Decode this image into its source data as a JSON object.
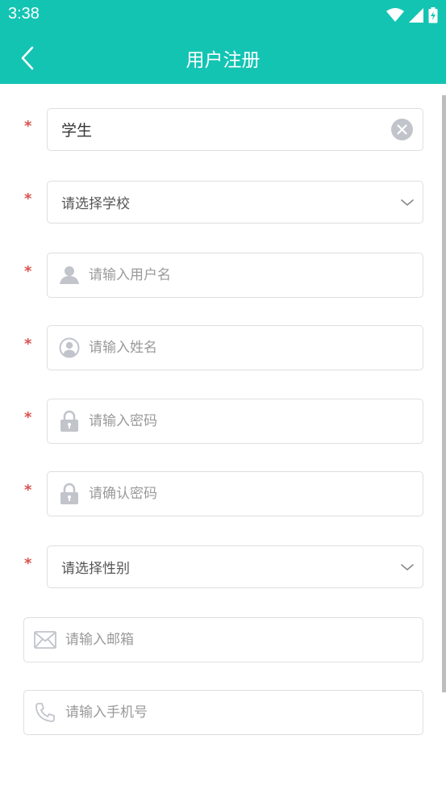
{
  "status_bar": {
    "time": "3:38"
  },
  "header": {
    "title": "用户注册"
  },
  "form": {
    "required_mark": "*",
    "role": {
      "value": "学生"
    },
    "school": {
      "label": "请选择学校"
    },
    "username": {
      "placeholder": "请输入用户名"
    },
    "realname": {
      "placeholder": "请输入姓名"
    },
    "password": {
      "placeholder": "请输入密码"
    },
    "confirm_password": {
      "placeholder": "请确认密码"
    },
    "gender": {
      "label": "请选择性别"
    },
    "email": {
      "placeholder": "请输入邮箱"
    },
    "phone": {
      "placeholder": "请输入手机号"
    }
  },
  "colors": {
    "header": "#13c4b3",
    "required": "#d9534f",
    "border": "#dedede",
    "icon": "#c2c4cc"
  },
  "icons": [
    "back-arrow-icon",
    "wifi-icon",
    "signal-icon",
    "battery-icon",
    "clear-icon",
    "chevron-down-icon",
    "user-icon",
    "user-circle-icon",
    "lock-icon",
    "mail-icon",
    "phone-icon"
  ]
}
